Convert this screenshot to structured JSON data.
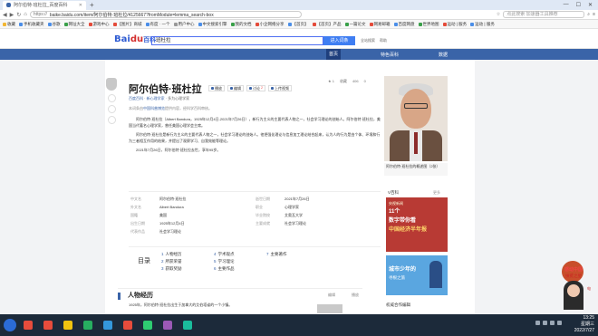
{
  "browser": {
    "tab_title": "阿尔伯特·班杜拉_百度百科",
    "new_tab": "+",
    "window_controls": [
      "—",
      "☐",
      "✕"
    ],
    "url_prefix": "https://",
    "url": "baike.baidu.com/item/阿尔伯特·班杜拉/4125667?fromModule=lemma_search-box",
    "address_search_placeholder": "点此搜索 加速器工具推荐",
    "bookmarks": [
      {
        "label": "收藏",
        "color": "#f2b632"
      },
      {
        "label": "手机收藏夹",
        "color": "#4b8ee8"
      },
      {
        "label": "谷歌",
        "color": "#4b8ee8"
      },
      {
        "label": "网址大全",
        "color": "#3aa04a"
      },
      {
        "label": "游戏中心",
        "color": "#e44b3a"
      },
      {
        "label": "【图片】商城",
        "color": "#e44b3a"
      },
      {
        "label": "有度 · 一个",
        "color": "#4b8ee8"
      },
      {
        "label": "用户中心",
        "color": "#999999"
      },
      {
        "label": "中文搜索引擎",
        "color": "#4b8ee8"
      },
      {
        "label": "我的文档",
        "color": "#3aa04a"
      },
      {
        "label": "小企网络分享",
        "color": "#e44b3a"
      },
      {
        "label": "【首页】",
        "color": "#4b8ee8"
      },
      {
        "label": "【首页】产品",
        "color": "#e44b3a"
      },
      {
        "label": "一篇论文",
        "color": "#3aa04a"
      },
      {
        "label": "网易邮箱",
        "color": "#e44b3a"
      },
      {
        "label": "百度网盘",
        "color": "#4b8ee8"
      },
      {
        "label": "世界地图",
        "color": "#3aa04a"
      },
      {
        "label": "运动 | 服务",
        "color": "#e44b3a"
      },
      {
        "label": "运动 | 服务",
        "color": "#4b8ee8"
      }
    ]
  },
  "header": {
    "logo_left": "Bai",
    "logo_du": "du",
    "logo_right": "百科",
    "search_value": "班杜拉",
    "search_button": "进入词条",
    "sublinks": [
      "全站搜索",
      "帮助"
    ]
  },
  "navstrip": {
    "active": "首页",
    "right": "特色百科",
    "far": "数据"
  },
  "article": {
    "title": "阿尔伯特·班杜拉",
    "tools": [
      "播放",
      "编辑",
      "讨论",
      "上传视频"
    ],
    "discuss_count": "2",
    "stats": [
      "1",
      "收藏",
      "406",
      "0"
    ],
    "breadcrumb_prefix": "百度百科",
    "breadcrumb": "新心理学家",
    "breadcrumb_suffix": "多为心理学家",
    "note_prefix": "本词条由",
    "note_link": "中国科普博览",
    "note_suffix": "提供内容，经科学百科审核。",
    "summary": [
      "阿尔伯特·班杜拉（Albert Bandura，1925年12月4日-2021年7月26日），新行为主义的主要代表人物之一，社会学习理论的创始人。阿尔伯特·班杜拉，美国当代著名心理学家，曾任美国心理学会主席。",
      "阿尔伯特·班杜拉是新行为主义的主要代表人物之一，社会学习理论的创始人。他把强化理论与信息加工理论结合起来，认为人的行为是由个体、环境和行为三者相互作用的结果，并提出了观察学习、自我效能等理论。",
      "2021年7月26日，阿尔伯特·班杜拉去世，享年95岁。"
    ],
    "info_left": [
      {
        "k": "中文名",
        "v": "阿尔伯特·班杜拉"
      },
      {
        "k": "外文名",
        "v": "Albert Bandura"
      },
      {
        "k": "国籍",
        "v": "美国"
      },
      {
        "k": "出生日期",
        "v": "1925年12月4日"
      },
      {
        "k": "代表作品",
        "v": "社会学习理论"
      }
    ],
    "info_right": [
      {
        "k": "逝世日期",
        "v": "2021年7月26日"
      },
      {
        "k": "职业",
        "v": "心理学家"
      },
      {
        "k": "毕业院校",
        "v": "艾奥瓦大学"
      },
      {
        "k": "主要成就",
        "v": "社会学习理论"
      }
    ],
    "toc_label": "目录",
    "toc": [
      {
        "n": "1",
        "t": "人物经历"
      },
      {
        "n": "2",
        "t": "所获荣誉"
      },
      {
        "n": "3",
        "t": "获取奖励"
      },
      {
        "n": "4",
        "t": "学术观点"
      },
      {
        "n": "5",
        "t": "学习理论"
      },
      {
        "n": "6",
        "t": "主要作品"
      },
      {
        "n": "7",
        "t": "主要著作"
      }
    ],
    "section_title": "人物经历",
    "section_edit": "编辑",
    "section_play": "播放",
    "section_text": "1925年，阿尔伯特·班杜拉出生于加拿大的艾伯塔省的一个小镇。"
  },
  "sidebar": {
    "photo_caption": "阿尔伯特·班杜拉的概述图（2张）",
    "v_label": "V百科",
    "v_more": "更多",
    "ad1_sub": "央视新闻",
    "ad1_line1": "11个",
    "ad1_line2": "数字带你看",
    "ad1_line3": "中国经济半年报",
    "ad2_line1": "城市少年的",
    "ad2_line2": "寻根之旅",
    "related": "权威合作编辑"
  },
  "floater": {
    "line1": "感动中国",
    "line2": "扶贫之星",
    "side": "电"
  },
  "taskbar": {
    "apps": [
      {
        "color": "#e74c3c"
      },
      {
        "color": "#e74c3c"
      },
      {
        "color": "#f1c40f"
      },
      {
        "color": "#27ae60"
      },
      {
        "color": "#3498db"
      },
      {
        "color": "#e74c3c"
      },
      {
        "color": "#2ecc71"
      },
      {
        "color": "#9b59b6"
      },
      {
        "color": "#1abc9c"
      }
    ],
    "time": "13:25",
    "day": "星期三",
    "date": "2022/7/27"
  }
}
